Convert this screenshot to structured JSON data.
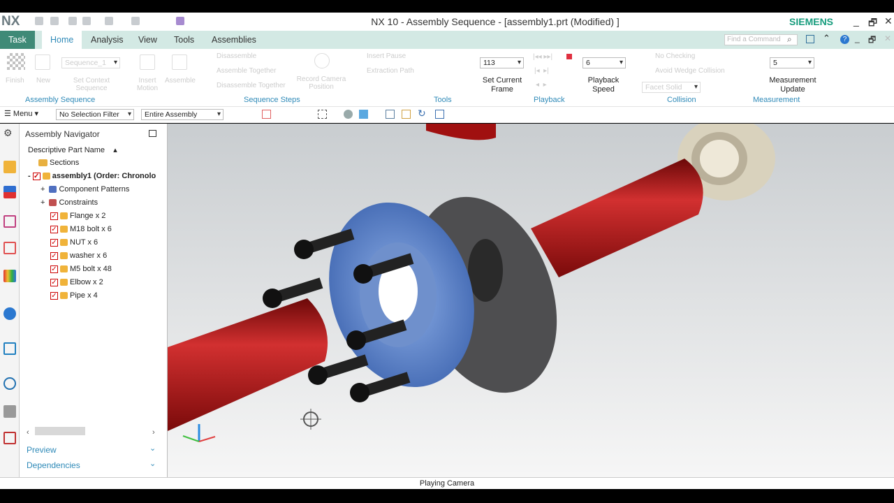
{
  "app": {
    "logo": "NX",
    "title": "NX 10 - Assembly Sequence - [assembly1.prt (Modified) ]",
    "brand": "SIEMENS",
    "find_placeholder": "Find a Command"
  },
  "tabs": [
    {
      "label": "Task"
    },
    {
      "label": "Home"
    },
    {
      "label": "Analysis"
    },
    {
      "label": "View"
    },
    {
      "label": "Tools"
    },
    {
      "label": "Assemblies"
    }
  ],
  "ribbon": {
    "assembly_sequence": {
      "group": "Assembly Sequence",
      "finish": "Finish",
      "new": "New",
      "sequence_combo": "Sequence_1",
      "set_context": "Set Context Sequence",
      "insert_motion": "Insert Motion",
      "assemble": "Assemble"
    },
    "sequence_steps": {
      "group": "Sequence Steps",
      "disassemble": "Disassemble",
      "assemble_together": "Assemble Together",
      "disassemble_together": "Disassemble Together",
      "record_camera": "Record Camera Position",
      "insert_pause": "Insert Pause",
      "extraction_path": "Extraction Path"
    },
    "tools": {
      "group": "Tools"
    },
    "playback": {
      "group": "Playback",
      "frame_value": "113",
      "set_current_frame": "Set Current Frame",
      "speed_value": "6",
      "playback_speed": "Playback Speed"
    },
    "collision": {
      "group": "Collision",
      "no_checking": "No Checking",
      "avoid_collision": "Avoid Wedge Collision",
      "facet_solid": "Facet Solid"
    },
    "measurement": {
      "group": "Measurement",
      "update_value": "5",
      "measurement_update": "Measurement Update"
    }
  },
  "toolbar": {
    "menu": "Menu",
    "selection_filter": "No Selection Filter",
    "scope": "Entire Assembly"
  },
  "navigator": {
    "title": "Assembly Navigator",
    "column": "Descriptive Part Name",
    "sections": "Sections",
    "root": "assembly1 (Order: Chronolo",
    "groups": [
      "Component Patterns",
      "Constraints"
    ],
    "items": [
      "Flange x 2",
      "M18 bolt x 6",
      "NUT x 6",
      "washer x 6",
      "M5 bolt x 48",
      "Elbow x 2",
      "Pipe x 4"
    ],
    "preview": "Preview",
    "dependencies": "Dependencies"
  },
  "status": {
    "text": "Playing Camera"
  },
  "colors": {
    "accent": "#2f8ab8",
    "task_tab": "#3f8a77",
    "brand": "#179c7d",
    "pipe": "#b01818",
    "flange_blue": "#5a7fc0",
    "flange_gray": "#5a5a5a"
  }
}
